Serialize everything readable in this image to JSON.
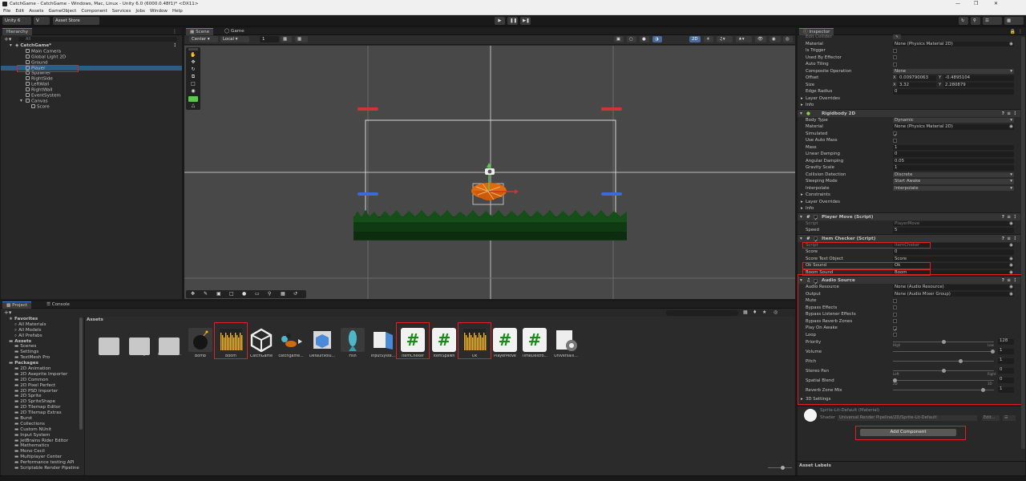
{
  "window": {
    "title": "CatchGame - CatchGame - Windows, Mac, Linux - Unity 6.0 (6000.0.48f1)* <DX11>"
  },
  "menu": [
    "File",
    "Edit",
    "Assets",
    "GameObject",
    "Component",
    "Services",
    "Jobs",
    "Window",
    "Help"
  ],
  "toolbar": {
    "unity_label": "Unity 6",
    "account_label": "V",
    "asset_store": "Asset Store"
  },
  "hierarchy": {
    "tab": "Hierarchy",
    "search_placeholder": "All",
    "scene": "CatchGame*",
    "items": [
      "Main Camera",
      "Global Light 2D",
      "Ground",
      "Player",
      "Spawner",
      "RightSide",
      "LeftWall",
      "RightWall",
      "EventSystem",
      "Canvas",
      "Score"
    ]
  },
  "scene": {
    "tab_scene": "Scene",
    "tab_game": "Game",
    "pivot": "Center",
    "space": "Local",
    "grid_snap": "1",
    "mode_2d": "2D"
  },
  "inspector": {
    "tab": "Inspector",
    "collider_rows": [
      {
        "label": "Edit Collider",
        "value": ""
      },
      {
        "label": "Material",
        "value": "None (Physics Material 2D)"
      },
      {
        "label": "Is Trigger",
        "value": ""
      },
      {
        "label": "Used By Effector",
        "value": ""
      },
      {
        "label": "Auto Tiling",
        "value": ""
      },
      {
        "label": "Composite Operation",
        "value": "None"
      },
      {
        "label": "Offset",
        "value": ""
      },
      {
        "label": "Size",
        "value": ""
      },
      {
        "label": "Edge Radius",
        "value": "0"
      },
      {
        "label": "Layer Overrides",
        "value": ""
      },
      {
        "label": "Info",
        "value": ""
      }
    ],
    "offset": {
      "x_label": "X",
      "x": "0.009790063",
      "y_label": "Y",
      "y": "-0.4895104"
    },
    "size": {
      "x_label": "X",
      "x": "3.32",
      "y_label": "Y",
      "y": "2.280879"
    },
    "rigidbody": {
      "title": "Rigidbody 2D",
      "rows": [
        {
          "label": "Body Type",
          "value": "Dynamic"
        },
        {
          "label": "Material",
          "value": "None (Physics Material 2D)"
        },
        {
          "label": "Simulated",
          "value": ""
        },
        {
          "label": "Use Auto Mass",
          "value": ""
        },
        {
          "label": "Mass",
          "value": "1"
        },
        {
          "label": "Linear Damping",
          "value": "0"
        },
        {
          "label": "Angular Damping",
          "value": "0.05"
        },
        {
          "label": "Gravity Scale",
          "value": "1"
        },
        {
          "label": "Collision Detection",
          "value": "Discrete"
        },
        {
          "label": "Sleeping Mode",
          "value": "Start Awake"
        },
        {
          "label": "Interpolate",
          "value": "Interpolate"
        },
        {
          "label": "Constraints",
          "value": ""
        },
        {
          "label": "Layer Overrides",
          "value": ""
        },
        {
          "label": "Info",
          "value": ""
        }
      ]
    },
    "player_move": {
      "title": "Player Move (Script)",
      "rows": [
        {
          "label": "Script",
          "value": "PlayerMove"
        },
        {
          "label": "Speed",
          "value": "5"
        }
      ]
    },
    "item_checker": {
      "title": "Item Checker (Script)",
      "rows": [
        {
          "label": "Script",
          "value": "ItemCheker"
        },
        {
          "label": "Score",
          "value": "0"
        },
        {
          "label": "Score Text Object",
          "value": "Score"
        },
        {
          "label": "Ok Sound",
          "value": "Ok"
        },
        {
          "label": "Boom Sound",
          "value": "Boom"
        }
      ]
    },
    "audio_source": {
      "title": "Audio Source",
      "rows": [
        {
          "label": "Audio Resource",
          "value": "None (Audio Resource)"
        },
        {
          "label": "Output",
          "value": "None (Audio Mixer Group)"
        },
        {
          "label": "Mute",
          "value": ""
        },
        {
          "label": "Bypass Effects",
          "value": ""
        },
        {
          "label": "Bypass Listener Effects",
          "value": ""
        },
        {
          "label": "Bypass Reverb Zones",
          "value": ""
        },
        {
          "label": "Play On Awake",
          "value": ""
        },
        {
          "label": "Loop",
          "value": ""
        }
      ],
      "sliders": [
        {
          "label": "Priority",
          "value": "128",
          "level": 0.5,
          "min_label": "High",
          "max_label": "Low"
        },
        {
          "label": "Volume",
          "value": "1",
          "level": 1.0
        },
        {
          "label": "Pitch",
          "value": "1",
          "level": 0.67
        },
        {
          "label": "Stereo Pan",
          "value": "0",
          "level": 0.5,
          "min_label": "Left",
          "max_label": "Right"
        },
        {
          "label": "Spatial Blend",
          "value": "0",
          "level": 0.0,
          "min_label": "2D",
          "max_label": "3D"
        },
        {
          "label": "Reverb Zone Mix",
          "value": "1",
          "level": 0.9
        }
      ],
      "settings_3d": "3D Settings"
    },
    "material": {
      "name": "Sprite-Lit-Default (Material)",
      "shader_label": "Shader",
      "shader": "Universal Render Pipeline/2D/Sprite-Lit-Default",
      "edit": "Edit...",
      "more": "☰"
    },
    "add_component": "Add Component",
    "asset_labels": "Asset Labels"
  },
  "project": {
    "tab_project": "Project",
    "tab_console": "Console",
    "breadcrumb": "Assets",
    "tree": [
      {
        "label": "Favorites",
        "level": 0,
        "bold": true
      },
      {
        "label": "All Materials",
        "level": 1
      },
      {
        "label": "All Models",
        "level": 1
      },
      {
        "label": "All Prefabs",
        "level": 1
      },
      {
        "label": "Assets",
        "level": 0,
        "bold": true
      },
      {
        "label": "Scenes",
        "level": 1
      },
      {
        "label": "Settings",
        "level": 1
      },
      {
        "label": "TextMesh Pro",
        "level": 1
      },
      {
        "label": "Packages",
        "level": 0,
        "bold": true
      },
      {
        "label": "2D Animation",
        "level": 1
      },
      {
        "label": "2D Aseprite Importer",
        "level": 1
      },
      {
        "label": "2D Common",
        "level": 1
      },
      {
        "label": "2D Pixel Perfect",
        "level": 1
      },
      {
        "label": "2D PSD Importer",
        "level": 1
      },
      {
        "label": "2D Sprite",
        "level": 1
      },
      {
        "label": "2D SpriteShape",
        "level": 1
      },
      {
        "label": "2D Tilemap Editor",
        "level": 1
      },
      {
        "label": "2D Tilemap Extras",
        "level": 1
      },
      {
        "label": "Burst",
        "level": 1
      },
      {
        "label": "Collections",
        "level": 1
      },
      {
        "label": "Custom NUnit",
        "level": 1
      },
      {
        "label": "Input System",
        "level": 1
      },
      {
        "label": "JetBrains Rider Editor",
        "level": 1
      },
      {
        "label": "Mathematics",
        "level": 1
      },
      {
        "label": "Mono Cecil",
        "level": 1
      },
      {
        "label": "Multiplayer Center",
        "level": 1
      },
      {
        "label": "Performance testing API",
        "level": 1
      },
      {
        "label": "Scriptable Render Pipeline",
        "level": 1
      }
    ],
    "assets": [
      {
        "label": "Scenes",
        "kind": "folder"
      },
      {
        "label": "Settings",
        "kind": "folder"
      },
      {
        "label": "TextMesh P...",
        "kind": "folder"
      },
      {
        "label": "Bomb",
        "kind": "bomb"
      },
      {
        "label": "Boom",
        "kind": "audio"
      },
      {
        "label": "CatchGame",
        "kind": "unity"
      },
      {
        "label": "catchgame...",
        "kind": "sprite"
      },
      {
        "label": "DefaultVolu...",
        "kind": "cube"
      },
      {
        "label": "Fish",
        "kind": "fish"
      },
      {
        "label": "InputSyste...",
        "kind": "input"
      },
      {
        "label": "ItemCheker",
        "kind": "script"
      },
      {
        "label": "ItemSpawn",
        "kind": "script"
      },
      {
        "label": "Ok",
        "kind": "audio"
      },
      {
        "label": "PlayerMove",
        "kind": "script"
      },
      {
        "label": "TimeDestro...",
        "kind": "script"
      },
      {
        "label": "Universalli...",
        "kind": "gear"
      }
    ]
  },
  "colors": {
    "accent": "#3d7ed8",
    "highlight_box": "#e02020",
    "panel_bg": "#282828",
    "scene_bg": "#484848",
    "selection": "#2c5d87"
  }
}
